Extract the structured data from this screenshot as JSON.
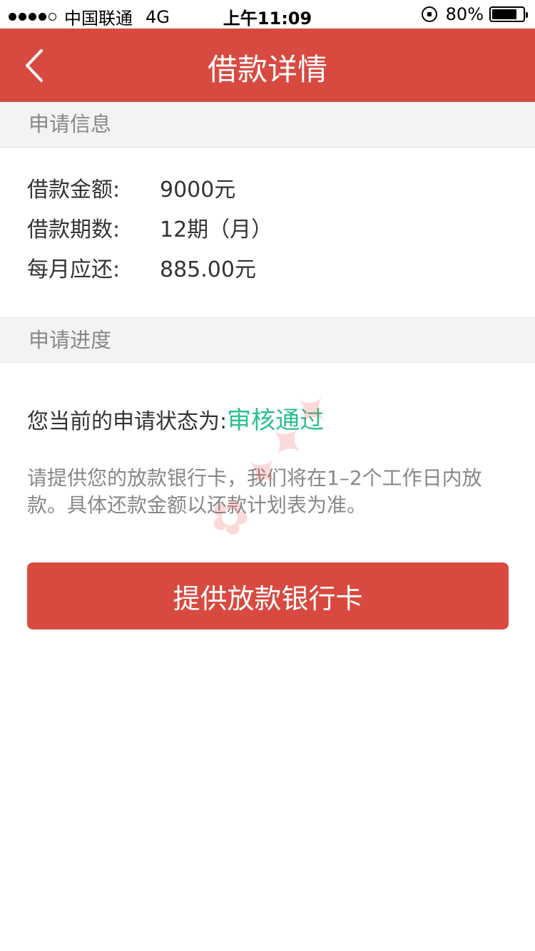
{
  "status_bar": {
    "carrier": "中国联通",
    "network": "4G",
    "time": "上午11:09",
    "battery": "80%",
    "battery_level": 0.8
  },
  "nav": {
    "title": "借款详情",
    "back_icon": "chevron-left-icon"
  },
  "application_info": {
    "header": "申请信息",
    "rows": [
      {
        "label": "借款金额:",
        "value": "9000元"
      },
      {
        "label": "借款期数:",
        "value": "12期（月）"
      },
      {
        "label": "每月应还:",
        "value": "885.00元"
      }
    ]
  },
  "progress": {
    "header": "申请进度",
    "status_label": "您当前的申请状态为:",
    "status_value": "审核通过",
    "note": "请提供您的放款银行卡，我们将在1–2个工作日内放款。具体还款金额以还款计划表为准。",
    "button_label": "提供放款银行卡"
  },
  "colors": {
    "accent": "#d84a40",
    "status_green": "#2bbf8f"
  }
}
